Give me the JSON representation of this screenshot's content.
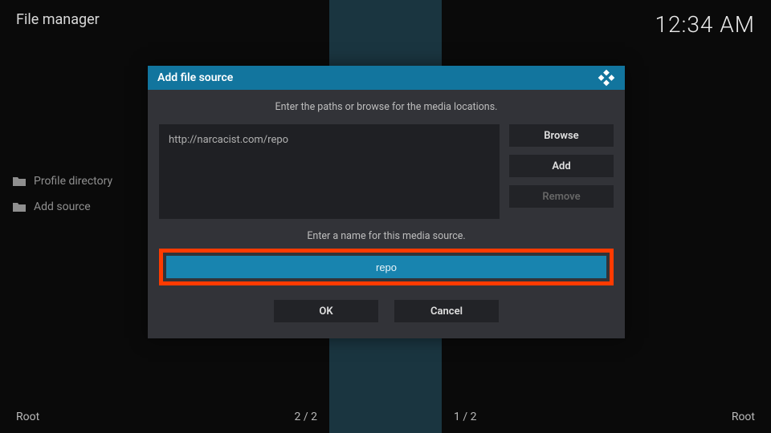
{
  "header": {
    "title": "File manager",
    "time": "12:34 AM"
  },
  "leftPanel": {
    "items": [
      {
        "label": "Profile directory"
      },
      {
        "label": "Add source"
      }
    ]
  },
  "footer": {
    "left": "Root",
    "center1": "2 / 2",
    "center2": "1 / 2",
    "right": "Root"
  },
  "dialog": {
    "title": "Add file source",
    "caption1": "Enter the paths or browse for the media locations.",
    "path_value": "http://narcacist.com/repo",
    "browse_label": "Browse",
    "add_label": "Add",
    "remove_label": "Remove",
    "caption2": "Enter a name for this media source.",
    "name_value": "repo",
    "ok_label": "OK",
    "cancel_label": "Cancel"
  }
}
